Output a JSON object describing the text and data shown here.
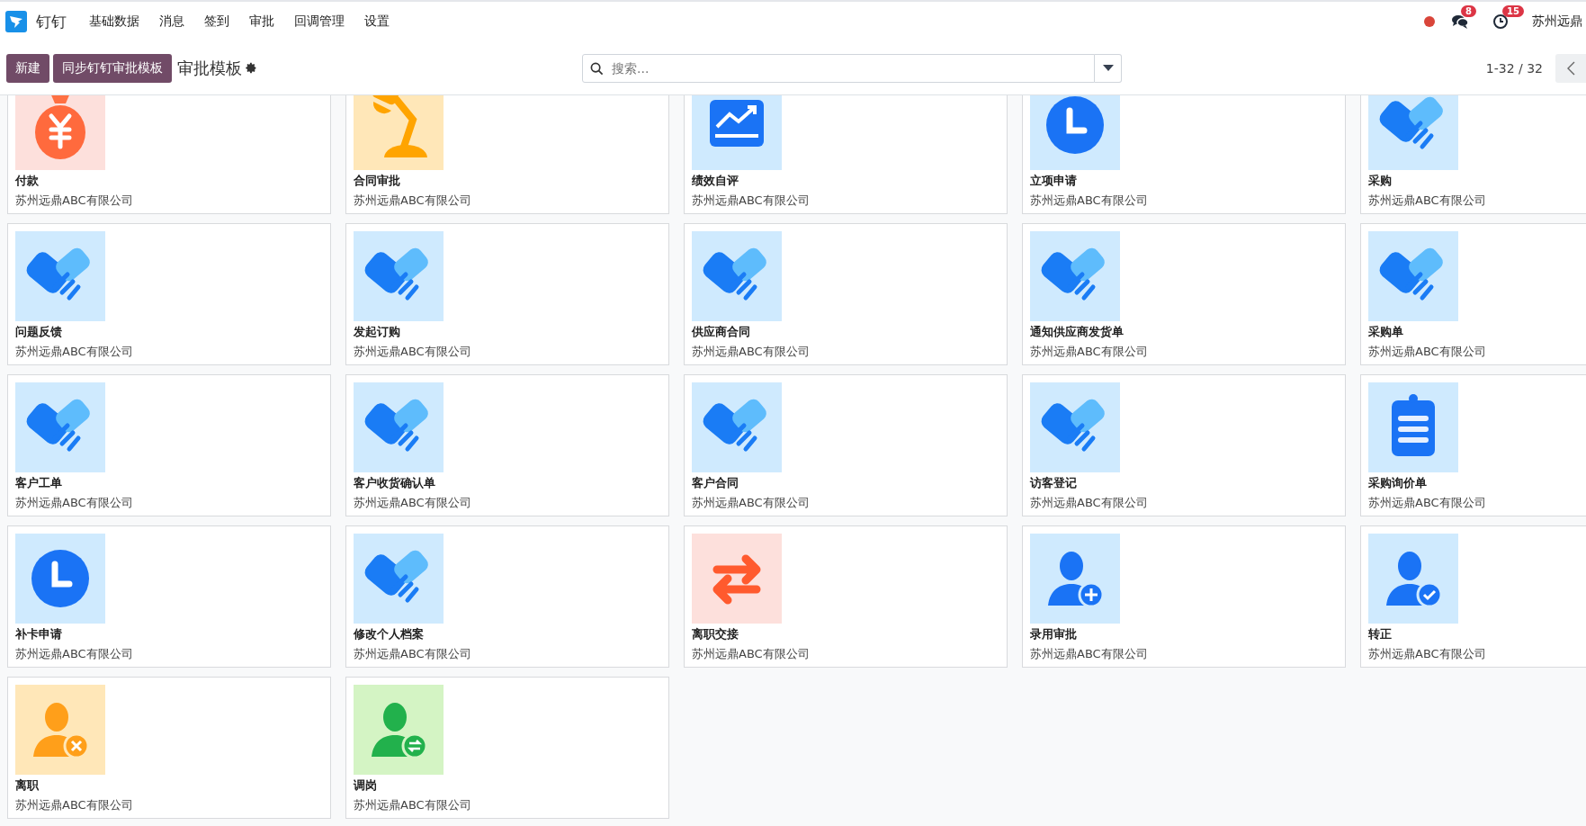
{
  "navbar": {
    "app_name": "钉钉",
    "menu": [
      "基础数据",
      "消息",
      "签到",
      "审批",
      "回调管理",
      "设置"
    ],
    "messages_badge": "8",
    "activities_badge": "15",
    "company": "苏州远鼎"
  },
  "control_panel": {
    "buttons": [
      "新建",
      "同步钉钉审批模板"
    ],
    "breadcrumb": "审批模板",
    "search": {
      "placeholder": "搜索..."
    },
    "pager": "1-32 / 32"
  },
  "cards": [
    {
      "title": "付款",
      "company": "苏州远鼎ABC有限公司",
      "kind": "money"
    },
    {
      "title": "合同审批",
      "company": "苏州远鼎ABC有限公司",
      "kind": "lamp"
    },
    {
      "title": "绩效自评",
      "company": "苏州远鼎ABC有限公司",
      "kind": "chart"
    },
    {
      "title": "立项申请",
      "company": "苏州远鼎ABC有限公司",
      "kind": "clock"
    },
    {
      "title": "采购",
      "company": "苏州远鼎ABC有限公司",
      "kind": "handshake"
    },
    {
      "title": "问题反馈",
      "company": "苏州远鼎ABC有限公司",
      "kind": "handshake"
    },
    {
      "title": "发起订购",
      "company": "苏州远鼎ABC有限公司",
      "kind": "handshake"
    },
    {
      "title": "供应商合同",
      "company": "苏州远鼎ABC有限公司",
      "kind": "handshake"
    },
    {
      "title": "通知供应商发货单",
      "company": "苏州远鼎ABC有限公司",
      "kind": "handshake"
    },
    {
      "title": "采购单",
      "company": "苏州远鼎ABC有限公司",
      "kind": "handshake"
    },
    {
      "title": "客户工单",
      "company": "苏州远鼎ABC有限公司",
      "kind": "handshake"
    },
    {
      "title": "客户收货确认单",
      "company": "苏州远鼎ABC有限公司",
      "kind": "handshake"
    },
    {
      "title": "客户合同",
      "company": "苏州远鼎ABC有限公司",
      "kind": "handshake"
    },
    {
      "title": "访客登记",
      "company": "苏州远鼎ABC有限公司",
      "kind": "handshake"
    },
    {
      "title": "采购询价单",
      "company": "苏州远鼎ABC有限公司",
      "kind": "clipboard"
    },
    {
      "title": "补卡申请",
      "company": "苏州远鼎ABC有限公司",
      "kind": "clock"
    },
    {
      "title": "修改个人档案",
      "company": "苏州远鼎ABC有限公司",
      "kind": "handshake"
    },
    {
      "title": "离职交接",
      "company": "苏州远鼎ABC有限公司",
      "kind": "swap"
    },
    {
      "title": "录用审批",
      "company": "苏州远鼎ABC有限公司",
      "kind": "person_add"
    },
    {
      "title": "转正",
      "company": "苏州远鼎ABC有限公司",
      "kind": "person_check"
    },
    {
      "title": "离职",
      "company": "苏州远鼎ABC有限公司",
      "kind": "person_remove"
    },
    {
      "title": "调岗",
      "company": "苏州远鼎ABC有限公司",
      "kind": "person_swap"
    }
  ]
}
